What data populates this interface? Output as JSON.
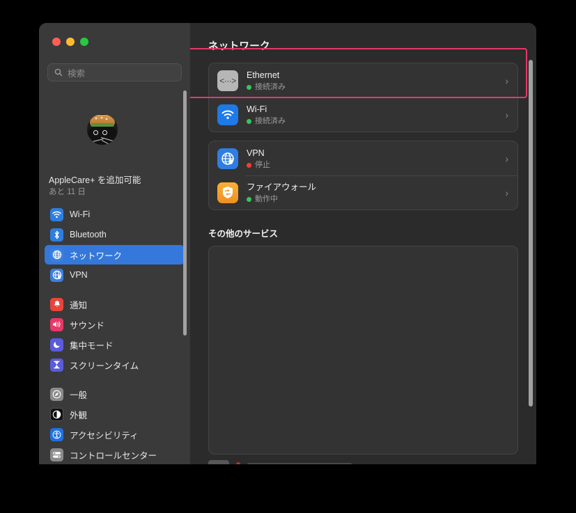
{
  "window": {
    "traffic_lights": [
      {
        "name": "close",
        "color": "#ff5f57"
      },
      {
        "name": "minimize",
        "color": "#febc2e"
      },
      {
        "name": "maximize",
        "color": "#28c840"
      }
    ]
  },
  "sidebar": {
    "search": {
      "placeholder": "検索",
      "value": "",
      "icon": "search-icon"
    },
    "avatar": {
      "icon": "user-avatar"
    },
    "applecare": {
      "title": "AppleCare+ を追加可能",
      "subtitle": "あと 11 日"
    },
    "groups": [
      {
        "items": [
          {
            "label": "Wi-Fi",
            "icon": "wifi-icon",
            "selected": false
          },
          {
            "label": "Bluetooth",
            "icon": "bluetooth-icon",
            "selected": false
          },
          {
            "label": "ネットワーク",
            "icon": "network-icon",
            "selected": true
          },
          {
            "label": "VPN",
            "icon": "vpn-icon",
            "selected": false
          }
        ]
      },
      {
        "items": [
          {
            "label": "通知",
            "icon": "notifications-icon",
            "selected": false
          },
          {
            "label": "サウンド",
            "icon": "sound-icon",
            "selected": false
          },
          {
            "label": "集中モード",
            "icon": "focus-icon",
            "selected": false
          },
          {
            "label": "スクリーンタイム",
            "icon": "screentime-icon",
            "selected": false
          }
        ]
      },
      {
        "items": [
          {
            "label": "一般",
            "icon": "general-icon",
            "selected": false
          },
          {
            "label": "外観",
            "icon": "appearance-icon",
            "selected": false
          },
          {
            "label": "アクセシビリティ",
            "icon": "accessibility-icon",
            "selected": false
          },
          {
            "label": "コントロールセンター",
            "icon": "controlcenter-icon",
            "selected": false
          }
        ]
      }
    ],
    "selected_color": "#3478dc"
  },
  "main": {
    "title": "ネットワーク",
    "services_section_title": "その他のサービス",
    "interfaces": [
      {
        "name": "Ethernet",
        "status": "接続済み",
        "status_color": "#34c759",
        "icon": "ethernet-icon",
        "chevron": "›",
        "highlighted": true
      },
      {
        "name": "Wi-Fi",
        "status": "接続済み",
        "status_color": "#34c759",
        "icon": "wifi-icon",
        "chevron": "›",
        "highlighted": false
      }
    ],
    "security": [
      {
        "name": "VPN",
        "status": "停止",
        "status_color": "#ff3b30",
        "icon": "vpn-icon",
        "chevron": "›"
      },
      {
        "name": "ファイアウォール",
        "status": "動作中",
        "status_color": "#34c759",
        "icon": "firewall-icon",
        "chevron": "›"
      }
    ],
    "highlight_color": "#e8376c"
  }
}
